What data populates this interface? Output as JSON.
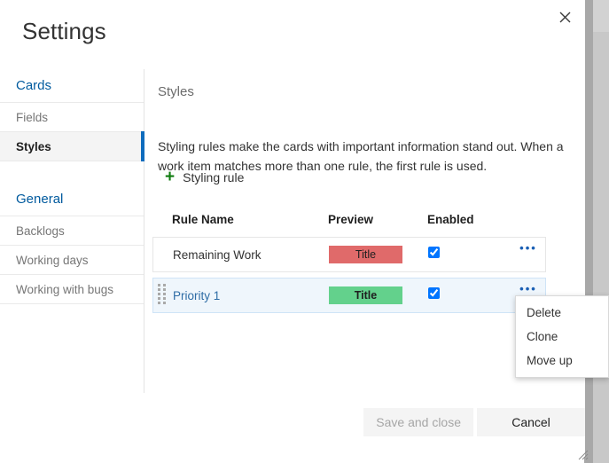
{
  "dialog": {
    "title": "Settings",
    "close_icon": "close-icon"
  },
  "sidebar": {
    "groups": [
      {
        "label": "Cards",
        "items": [
          {
            "label": "Fields",
            "selected": false
          },
          {
            "label": "Styles",
            "selected": true
          }
        ]
      },
      {
        "label": "General",
        "items": [
          {
            "label": "Backlogs",
            "selected": false
          },
          {
            "label": "Working days",
            "selected": false
          },
          {
            "label": "Working with bugs",
            "selected": false
          }
        ]
      }
    ]
  },
  "content": {
    "heading": "Styles",
    "description": "Styling rules make the cards with important information stand out. When a work item matches more than one rule, the first rule is used.",
    "add_rule": {
      "plus_glyph": "+",
      "label": "Styling rule",
      "icon": "plus-icon",
      "accent_color": "#107c10"
    },
    "table": {
      "columns": [
        "Rule Name",
        "Preview",
        "Enabled"
      ],
      "rows": [
        {
          "name": "Remaining Work",
          "preview_text": "Title",
          "preview_color": "#e06a6a",
          "preview_bold": false,
          "enabled": true,
          "selected": false,
          "has_drag_handle": false,
          "menu_glyph": "•••"
        },
        {
          "name": "Priority 1",
          "preview_text": "Title",
          "preview_color": "#63d18c",
          "preview_bold": true,
          "enabled": true,
          "selected": true,
          "has_drag_handle": true,
          "menu_glyph": "•••"
        }
      ]
    }
  },
  "context_menu": {
    "items": [
      "Delete",
      "Clone",
      "Move up"
    ]
  },
  "footer": {
    "save_label": "Save and close",
    "save_disabled": true,
    "cancel_label": "Cancel"
  },
  "colors": {
    "accent": "#0f6cbd",
    "link": "#005a9e",
    "selected_row_bg": "#eff6fc",
    "green": "#107c10"
  }
}
